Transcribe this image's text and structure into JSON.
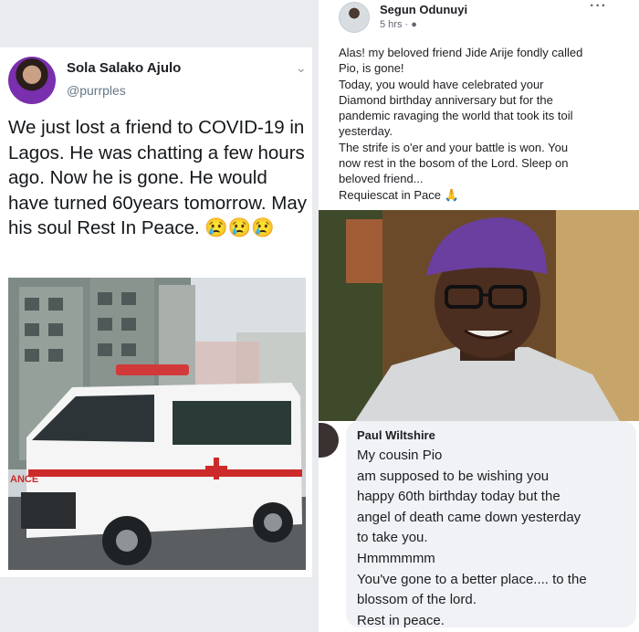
{
  "tweet": {
    "author_name": "Sola Salako Ajulo",
    "handle": "@purrples",
    "text": "We just lost a friend to COVID-19 in Lagos. He was chatting a few hours ago. Now he is gone. He would have turned 60years tomorrow. May his soul Rest In Peace. 😢😢😢",
    "ambulance_label": "ANCE"
  },
  "facebook_post": {
    "author_name": "Segun Odunuyi",
    "timestamp": "5 hrs · ",
    "lines": [
      "Alas! my beloved friend Jide Arije fondly called",
      "Pio, is gone!",
      "Today, you would have celebrated your",
      "Diamond birthday anniversary but for the",
      "pandemic ravaging the world that took its toil",
      "yesterday.",
      "The strife is o'er and your battle is won. You",
      "now rest in the bosom of the Lord. Sleep on",
      "beloved friend...",
      "Requiescat in Pace 🙏"
    ]
  },
  "facebook_comment": {
    "author_name": "Paul Wiltshire",
    "lines": [
      "My cousin Pio",
      "am supposed to be wishing you",
      "happy 60th birthday today but the",
      "angel of death came down yesterday",
      "to take you.",
      "Hmmmmmm",
      "You've gone to a better place.... to the",
      "blossom of the lord.",
      "Rest in peace."
    ]
  }
}
